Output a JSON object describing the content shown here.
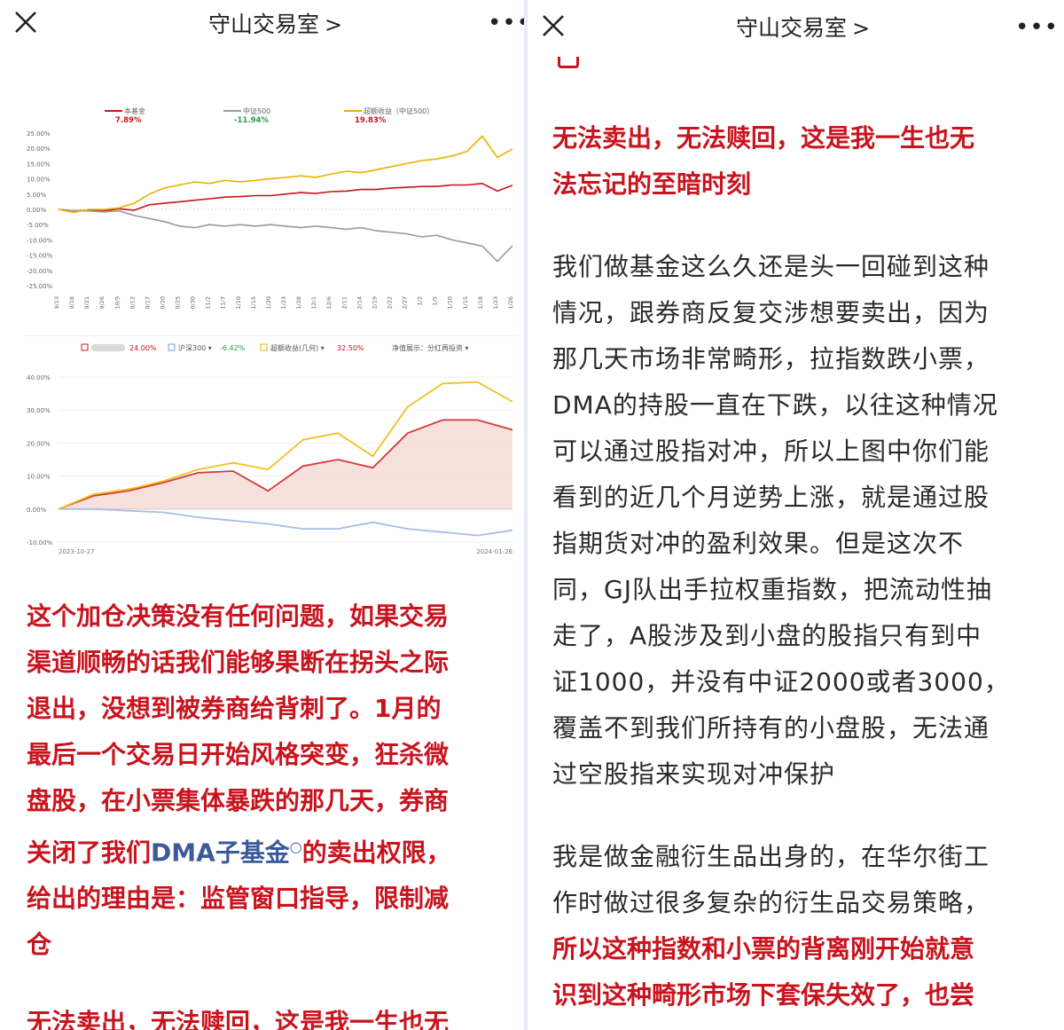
{
  "left_pane": {
    "header": {
      "title": "守山交易室",
      "chevron": ">",
      "close_icon": "close-icon",
      "more_icon": "more-icon"
    },
    "chart1": {
      "legend": [
        {
          "name": "本基金",
          "value": "7.89%",
          "color": "#c8141e"
        },
        {
          "name": "中证500",
          "value": "-11.94%",
          "color": "#9a9a9a"
        },
        {
          "name": "超额收益（中证500）",
          "value": "19.83%",
          "color": "#e8b100"
        }
      ],
      "y_ticks": [
        "25.00%",
        "20.00%",
        "15.00%",
        "10.00%",
        "5.00%",
        "0.00%",
        "-5.00%",
        "-10.00%",
        "-15.00%",
        "-20.00%",
        "-25.00%"
      ],
      "x_ticks": [
        "9/13",
        "9/18",
        "9/21",
        "9/26",
        "10/9",
        "10/12",
        "10/17",
        "10/20",
        "10/25",
        "10/30",
        "11/2",
        "11/7",
        "11/10",
        "11/15",
        "11/20",
        "11/23",
        "11/28",
        "12/1",
        "12/6",
        "12/11",
        "12/14",
        "12/19",
        "12/22",
        "12/27",
        "1/2",
        "1/5",
        "1/10",
        "1/15",
        "1/18",
        "1/23",
        "1/26"
      ]
    },
    "chart2": {
      "legend": [
        {
          "name": "24.00%",
          "color": "#c8141e",
          "blurred": true
        },
        {
          "name": "沪深300",
          "value": "-6.42%",
          "color": "#7b9fe0"
        },
        {
          "name": "超额收益(几何)",
          "value": "32.50%",
          "color": "#e8b100"
        }
      ],
      "legend_extra": "净值展示：分红再投资",
      "y_ticks": [
        "40.00%",
        "30.00%",
        "20.00%",
        "10.00%",
        "0.00%",
        "-10.00%"
      ],
      "x_start": "2023-10-27",
      "x_end": "2024-01-26"
    },
    "paragraph_red": [
      "这个加仓决策没有任何问题，如果交易",
      "渠道顺畅的话我们能够果断在拐头之际",
      "退出，没想到被券商给背刺了。1月的",
      "最后一个交易日开始风格突变，狂杀微",
      "盘股，在小票集体暴跌的那几天，券商"
    ],
    "paragraph_red_line6_pre": "关闭了我们",
    "paragraph_red_link": "DMA子基金",
    "paragraph_red_line6_post": "的卖出权限，",
    "paragraph_red_rest": [
      "给出的理由是：监管窗口指导，限制减",
      "仓"
    ],
    "cut_bottom": "无法卖出，无法赎回，这是我一生也无"
  },
  "right_pane": {
    "header": {
      "title": "守山交易室",
      "chevron": ">",
      "close_icon": "close-icon",
      "more_icon": "more-icon"
    },
    "heading_red": [
      "无法卖出，无法赎回，这是我一生也无",
      "法忘记的至暗时刻"
    ],
    "paragraph1": [
      "我们做基金这么久还是头一回碰到这种",
      "情况，跟券商反复交涉想要卖出，因为",
      "那几天市场非常畸形，拉指数跌小票，",
      "DMA的持股一直在下跌，以往这种情况",
      "可以通过股指对冲，所以上图中你们能",
      "看到的近几个月逆势上涨，就是通过股",
      "指期货对冲的盈利效果。但是这次不",
      "同，GJ队出手拉权重指数，把流动性抽",
      "走了，A股涉及到小盘的股指只有到中",
      "证1000，并没有中证2000或者3000，",
      "覆盖不到我们所持有的小盘股，无法通",
      "过空股指来实现对冲保护"
    ],
    "paragraph2_normal": [
      "我是做金融衍生品出身的，在华尔街工",
      "作时做过很多复杂的衍生品交易策略，"
    ],
    "paragraph2_red": [
      "所以这种指数和小票的背离刚开始就意",
      "识到这种畸形市场下套保失效了，也尝"
    ]
  },
  "chart_data": [
    {
      "type": "line",
      "series": [
        {
          "name": "本基金",
          "values": [
            0,
            -0.5,
            -0.3,
            -0.5,
            0.2,
            -0.3,
            1.5,
            2.0,
            2.5,
            3.0,
            3.5,
            4.0,
            4.2,
            4.5,
            4.5,
            5.0,
            5.5,
            5.2,
            5.8,
            6.0,
            6.5,
            6.5,
            7.0,
            7.2,
            7.5,
            7.5,
            8.0,
            8.0,
            8.5,
            6.0,
            7.89
          ]
        },
        {
          "name": "中证500",
          "values": [
            0,
            -0.5,
            -0.5,
            -0.8,
            -0.5,
            -2.0,
            -3.0,
            -4.0,
            -5.5,
            -6.0,
            -5.0,
            -5.5,
            -5.0,
            -5.5,
            -5.0,
            -5.5,
            -6.0,
            -5.5,
            -6.0,
            -6.5,
            -6.0,
            -7.0,
            -7.5,
            -8.0,
            -9.0,
            -8.5,
            -10.0,
            -11.0,
            -12.0,
            -17.0,
            -11.94
          ]
        },
        {
          "name": "超额收益（中证500）",
          "values": [
            0,
            -1.0,
            0.0,
            0.0,
            0.5,
            2.0,
            5.0,
            7.0,
            8.0,
            9.0,
            8.5,
            9.5,
            9.0,
            9.5,
            10.0,
            10.5,
            11.0,
            10.5,
            11.5,
            12.5,
            12.0,
            13.0,
            14.0,
            15.0,
            16.0,
            16.5,
            17.5,
            19.0,
            24.0,
            17.0,
            19.83
          ]
        }
      ],
      "x": [
        "9/13",
        "9/18",
        "9/21",
        "9/26",
        "10/9",
        "10/12",
        "10/17",
        "10/20",
        "10/25",
        "10/30",
        "11/2",
        "11/7",
        "11/10",
        "11/15",
        "11/20",
        "11/23",
        "11/28",
        "12/1",
        "12/6",
        "12/11",
        "12/14",
        "12/19",
        "12/22",
        "12/27",
        "1/2",
        "1/5",
        "1/10",
        "1/15",
        "1/18",
        "1/23",
        "1/26"
      ],
      "ylim": [
        -25,
        25
      ]
    },
    {
      "type": "area",
      "x": [
        "2023-10-27",
        "",
        "",
        "",
        "",
        "",
        "",
        "",
        "",
        "",
        "",
        "",
        "",
        "2024-01-26"
      ],
      "series": [
        {
          "name": "",
          "values": [
            0,
            4,
            5.5,
            8,
            11,
            11.5,
            5.5,
            13,
            15,
            12.5,
            23,
            27,
            27,
            24
          ]
        },
        {
          "name": "沪深300",
          "values": [
            0,
            0,
            -0.5,
            -1,
            -2.5,
            -3.5,
            -4.5,
            -6,
            -6,
            -4,
            -6,
            -7,
            -8,
            -6.42
          ]
        },
        {
          "name": "超额收益(几何)",
          "values": [
            0,
            4.5,
            6,
            8.5,
            12,
            14,
            12,
            21,
            23,
            16,
            31,
            38,
            38.5,
            32.5
          ]
        }
      ],
      "ylim": [
        -10,
        40
      ]
    }
  ]
}
